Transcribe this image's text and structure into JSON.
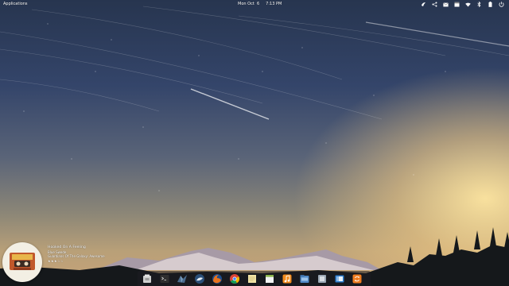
{
  "top_panel": {
    "applications_label": "Applications",
    "date": "Mon Oct  6",
    "time": "7:13 PM",
    "indicators": [
      "bird-indicator-icon",
      "share-icon",
      "mail-icon",
      "calendar-indicator-icon",
      "wifi-icon",
      "bluetooth-icon",
      "battery-icon",
      "power-icon"
    ]
  },
  "now_playing": {
    "title": "Hooked On A Feeling",
    "artist": "Blue Swede",
    "album": "Guardians Of The Galaxy: Awesome",
    "rating": "★★★☆☆"
  },
  "dock": {
    "items": [
      "files-icon",
      "terminal-icon",
      "mail-app-icon",
      "shotwell-icon",
      "firefox-icon",
      "chrome-icon",
      "notes-icon",
      "calendar-app-icon",
      "music-icon",
      "file-manager-icon",
      "screenshot-icon",
      "switchboard-icon",
      "update-icon"
    ]
  },
  "colors": {
    "sky_top": "#27354f",
    "sky_glow": "#f3d69a",
    "dock_bg": "#1e1e23"
  }
}
